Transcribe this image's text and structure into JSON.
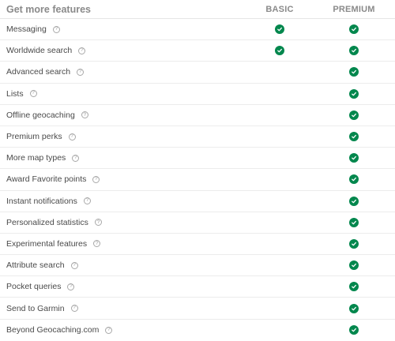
{
  "header": {
    "title": "Get more features",
    "basic": "BASIC",
    "premium": "PREMIUM"
  },
  "colors": {
    "check": "#02874d",
    "text": "#4a4a4a",
    "header_text": "#8a8a8a",
    "divider": "#ececec"
  },
  "help_glyph": "?",
  "features": [
    {
      "label": "Messaging",
      "basic": true,
      "premium": true
    },
    {
      "label": "Worldwide search",
      "basic": true,
      "premium": true
    },
    {
      "label": "Advanced search",
      "basic": false,
      "premium": true
    },
    {
      "label": "Lists",
      "basic": false,
      "premium": true
    },
    {
      "label": "Offline geocaching",
      "basic": false,
      "premium": true
    },
    {
      "label": "Premium perks",
      "basic": false,
      "premium": true
    },
    {
      "label": "More map types",
      "basic": false,
      "premium": true
    },
    {
      "label": "Award Favorite points",
      "basic": false,
      "premium": true
    },
    {
      "label": "Instant notifications",
      "basic": false,
      "premium": true
    },
    {
      "label": "Personalized statistics",
      "basic": false,
      "premium": true
    },
    {
      "label": "Experimental features",
      "basic": false,
      "premium": true
    },
    {
      "label": "Attribute search",
      "basic": false,
      "premium": true
    },
    {
      "label": "Pocket queries",
      "basic": false,
      "premium": true
    },
    {
      "label": "Send to Garmin",
      "basic": false,
      "premium": true
    },
    {
      "label": "Beyond Geocaching.com",
      "basic": false,
      "premium": true
    }
  ]
}
